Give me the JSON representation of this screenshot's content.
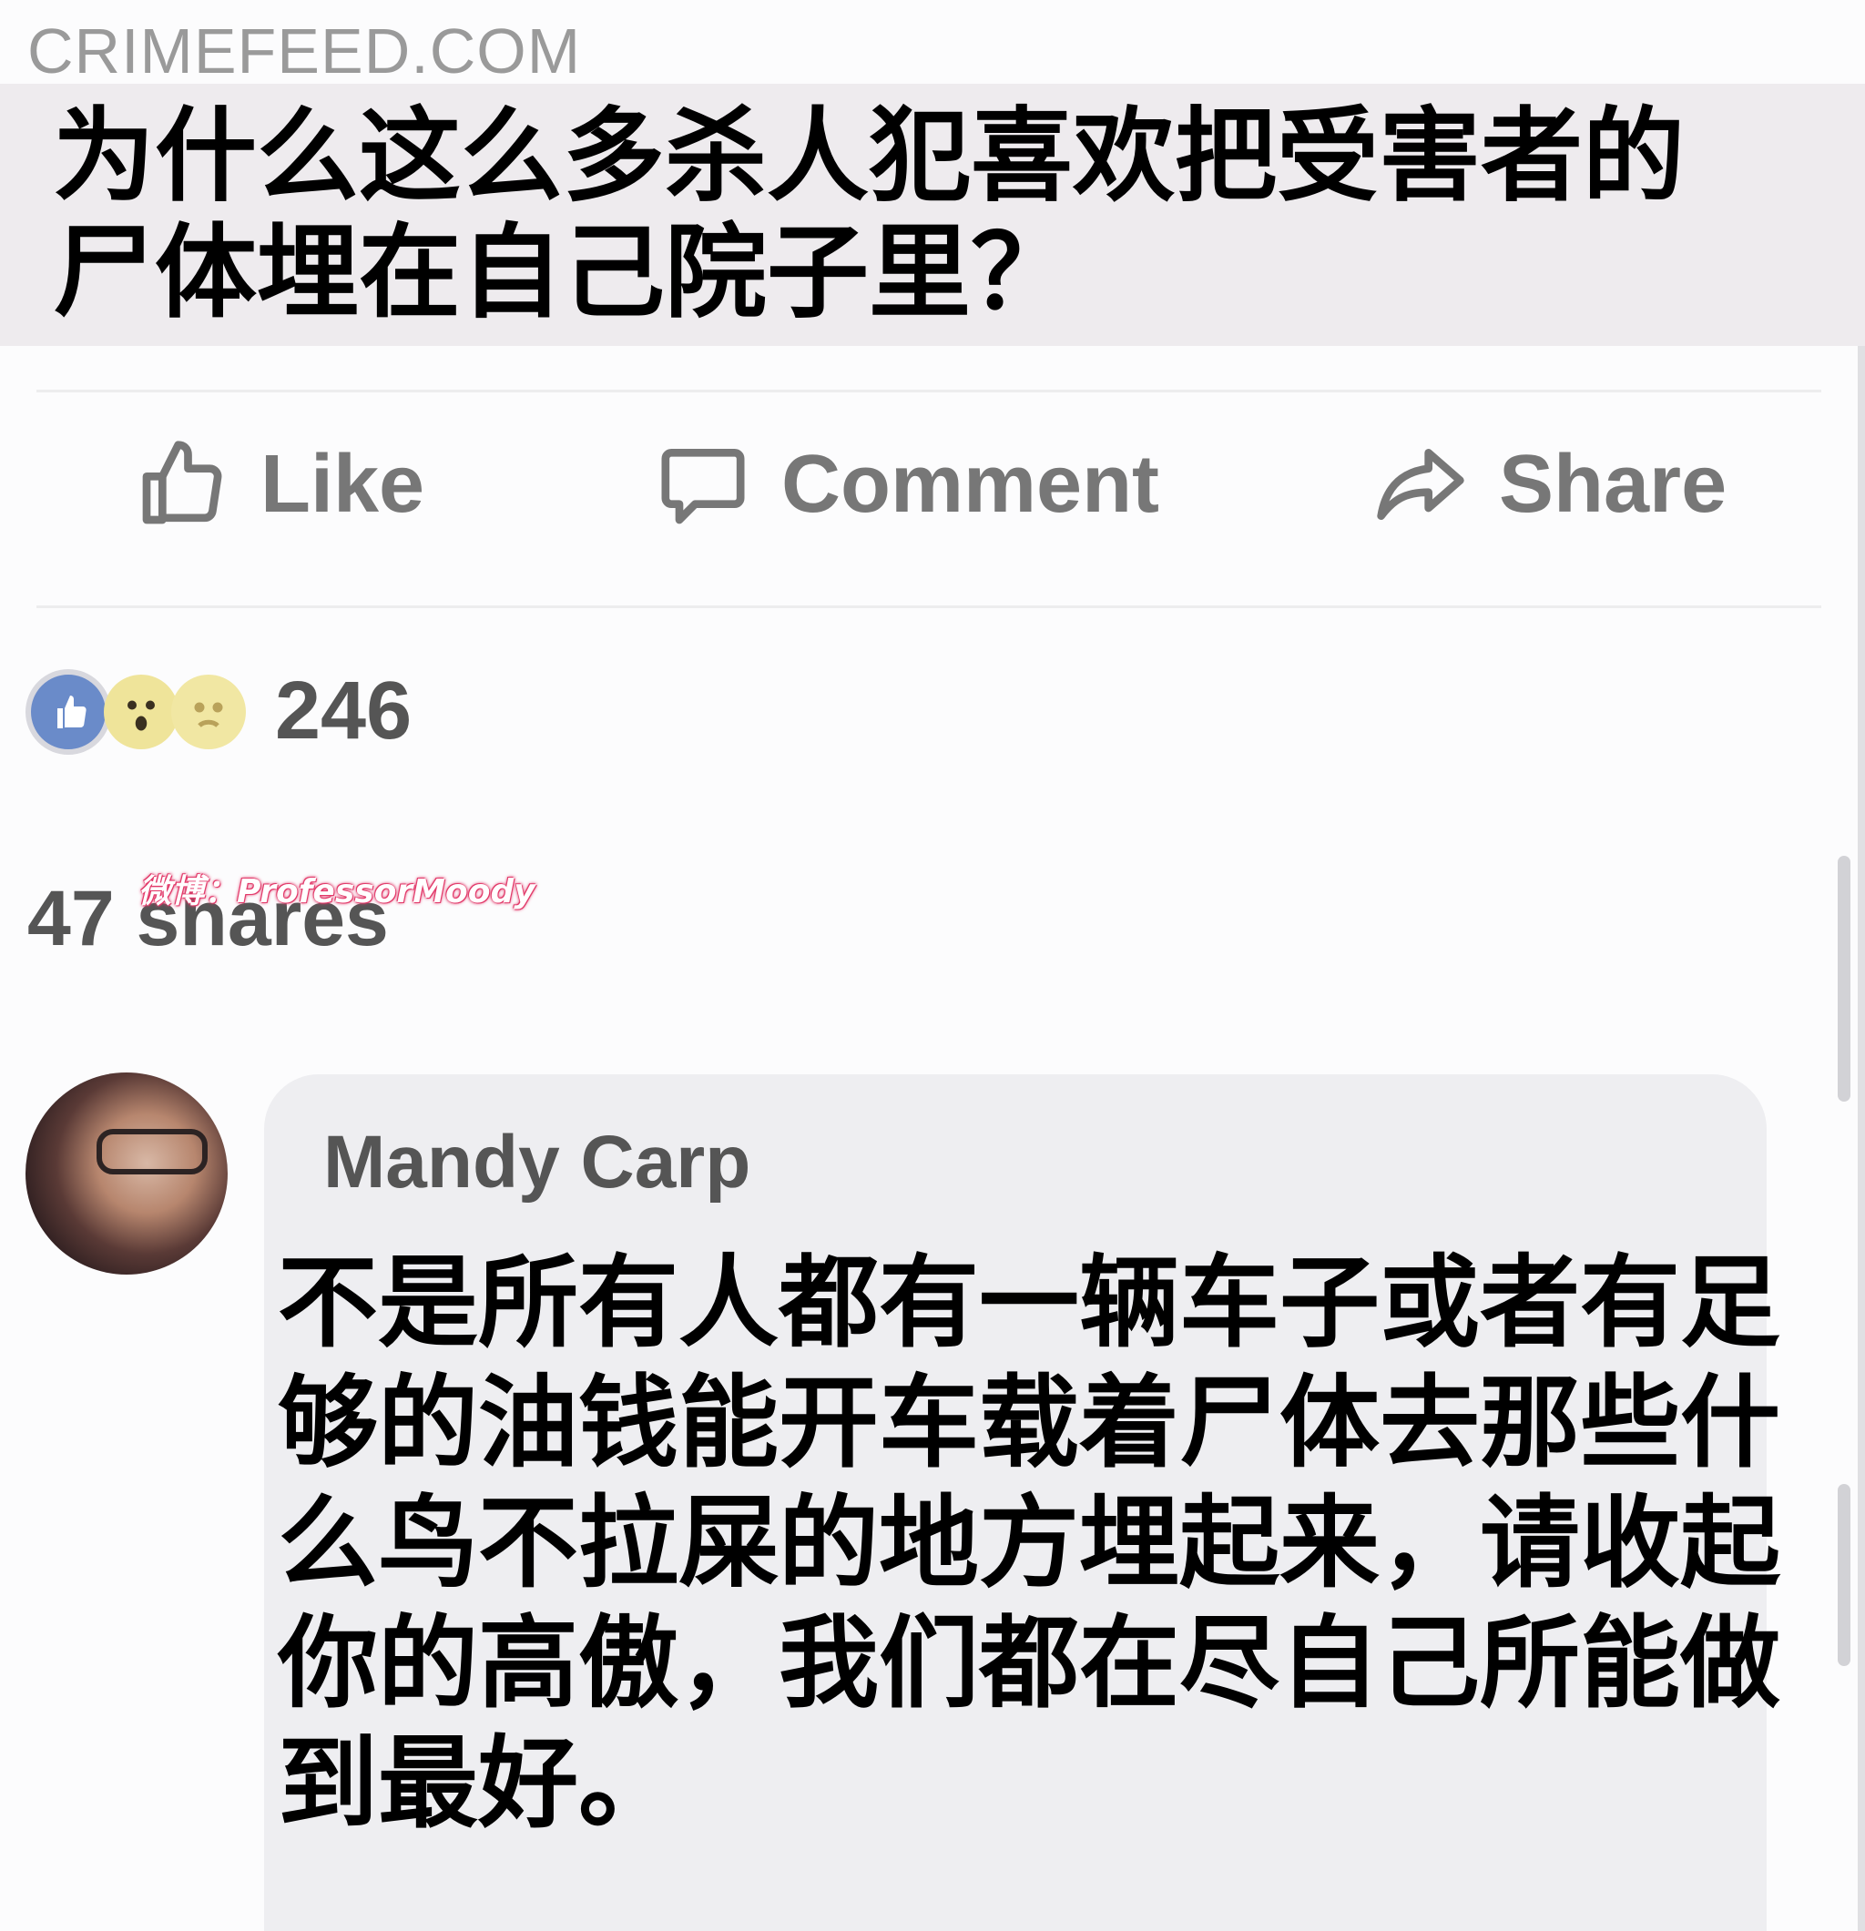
{
  "header": {
    "site": "CRIMEFEED.COM",
    "title": "为什么这么多杀人犯喜欢把受害者的尸体埋在自己院子里？"
  },
  "actions": {
    "like_label": "Like",
    "comment_label": "Comment",
    "share_label": "Share"
  },
  "reactions": {
    "icons": [
      "like-icon",
      "wow-icon",
      "sad-icon"
    ],
    "count": "246"
  },
  "shares": {
    "label": "47 shares"
  },
  "watermark": {
    "text": "微博：ProfessorMoody"
  },
  "comment": {
    "author": "Mandy Carp",
    "text": "不是所有人都有一辆车子或者有足够的油钱能开车载着尸体去那些什么鸟不拉屎的地方埋起来，请收起你的高傲，我们都在尽自己所能做到最好。"
  },
  "colors": {
    "title_band": "#eeebee",
    "comment_bubble": "#eeeef1",
    "action_text": "#777777",
    "like_blue": "#6a8bc9",
    "watermark_outline": "#e23a6a"
  }
}
